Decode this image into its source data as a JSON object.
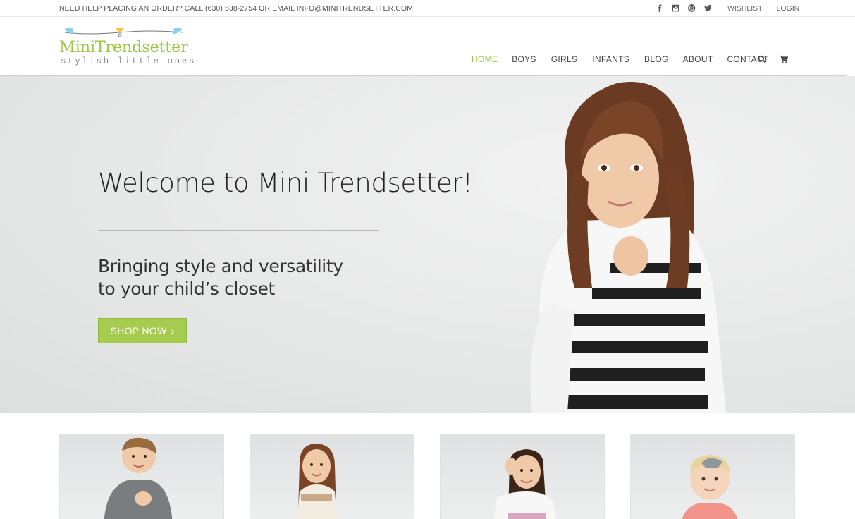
{
  "topbar": {
    "help_text": "NEED HELP PLACING AN ORDER? CALL (630) 538-2754 OR EMAIL INFO@MINITRENDSETTER.COM",
    "social_icons": [
      "facebook-icon",
      "instagram-icon",
      "pinterest-icon",
      "twitter-icon"
    ],
    "wishlist": "WISHLIST",
    "login": "LOGIN"
  },
  "header": {
    "logo_brand": "MiniTrendsetter",
    "logo_tagline": "stylish little ones",
    "nav": [
      "HOME",
      "BOYS",
      "GIRLS",
      "INFANTS",
      "BLOG",
      "ABOUT",
      "CONTACT"
    ],
    "active_nav": "HOME",
    "icons": [
      "search-icon",
      "cart-icon"
    ]
  },
  "hero": {
    "title": "Welcome to Mini Trendsetter!",
    "subtitle_line1": "Bringing style and versatility",
    "subtitle_line2": "to your child’s closet",
    "button_label": "SHOP NOW",
    "button_chevron": "›"
  },
  "colors": {
    "accent": "#9cc64a",
    "button": "#a6cc4f",
    "text": "#333333"
  }
}
